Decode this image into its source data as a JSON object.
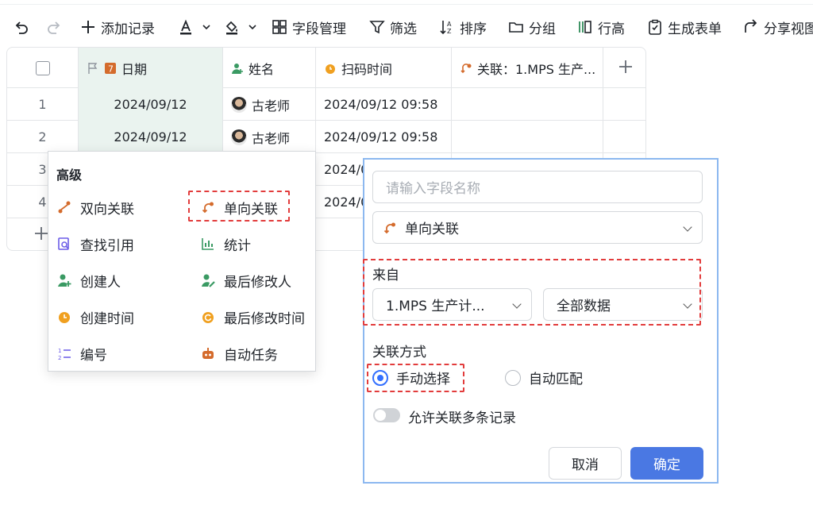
{
  "toolbar": {
    "add_record": "添加记录",
    "field_manage": "字段管理",
    "filter": "筛选",
    "sort": "排序",
    "group": "分组",
    "row_height": "行高",
    "gen_form": "生成表单",
    "share_view": "分享视图"
  },
  "grid": {
    "headers": [
      "日期",
      "姓名",
      "扫码时间",
      "关联：1.MPS 生产..."
    ],
    "rows": [
      {
        "num": "1",
        "date": "2024/09/12",
        "name": "古老师",
        "scan": "2024/09/12 09:58"
      },
      {
        "num": "2",
        "date": "2024/09/12",
        "name": "古老师",
        "scan": "2024/09/12 09:58"
      },
      {
        "num": "3",
        "scan": "2024/0"
      },
      {
        "num": "4",
        "scan": "2024/0"
      }
    ]
  },
  "menu": {
    "title": "高级",
    "items": [
      "双向关联",
      "单向关联",
      "查找引用",
      "统计",
      "创建人",
      "最后修改人",
      "创建时间",
      "最后修改时间",
      "编号",
      "自动任务"
    ]
  },
  "dialog": {
    "name_placeholder": "请输入字段名称",
    "field_type": "单向关联",
    "from_label": "来自",
    "source_table": "1.MPS 生产计...",
    "data_scope": "全部数据",
    "link_mode_label": "关联方式",
    "manual_select": "手动选择",
    "auto_match": "自动匹配",
    "allow_multi": "允许关联多条记录",
    "cancel": "取消",
    "confirm": "确定"
  },
  "colors": {
    "accent": "#4a78e3",
    "highlight_border": "#e23c3c",
    "date_column_bg": "#eaf3ef"
  }
}
